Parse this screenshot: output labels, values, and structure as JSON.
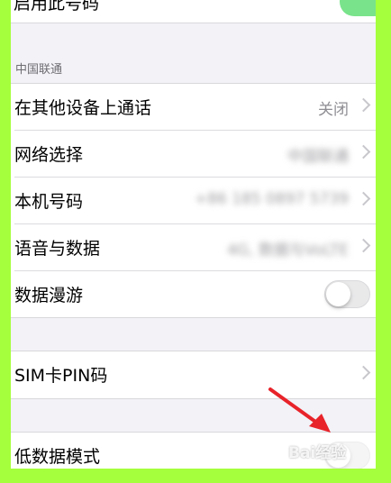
{
  "top_row": {
    "label": "启用此号码"
  },
  "carrier_section": {
    "header": "中国联通",
    "rows": [
      {
        "label": "在其他设备上通话",
        "value": "关闭"
      },
      {
        "label": "网络选择",
        "value": "中国联通"
      },
      {
        "label": "本机号码",
        "value": "+86 185 0897 5739"
      },
      {
        "label": "语音与数据",
        "value": "4G, 数据与VoLTE"
      },
      {
        "label": "数据漫游",
        "toggle": "off"
      }
    ]
  },
  "sim_section": {
    "rows": [
      {
        "label": "SIM卡PIN码"
      }
    ]
  },
  "low_data_section": {
    "rows": [
      {
        "label": "低数据模式",
        "toggle": "off"
      }
    ]
  },
  "annotation": {
    "arrow_color": "#e8232a",
    "watermark_text": "Bai经验"
  },
  "colors": {
    "frame_border": "#a6ff3c",
    "screen_background": "#f2f2f7",
    "row_background": "#ffffff",
    "secondary_text": "#8e8e93"
  }
}
